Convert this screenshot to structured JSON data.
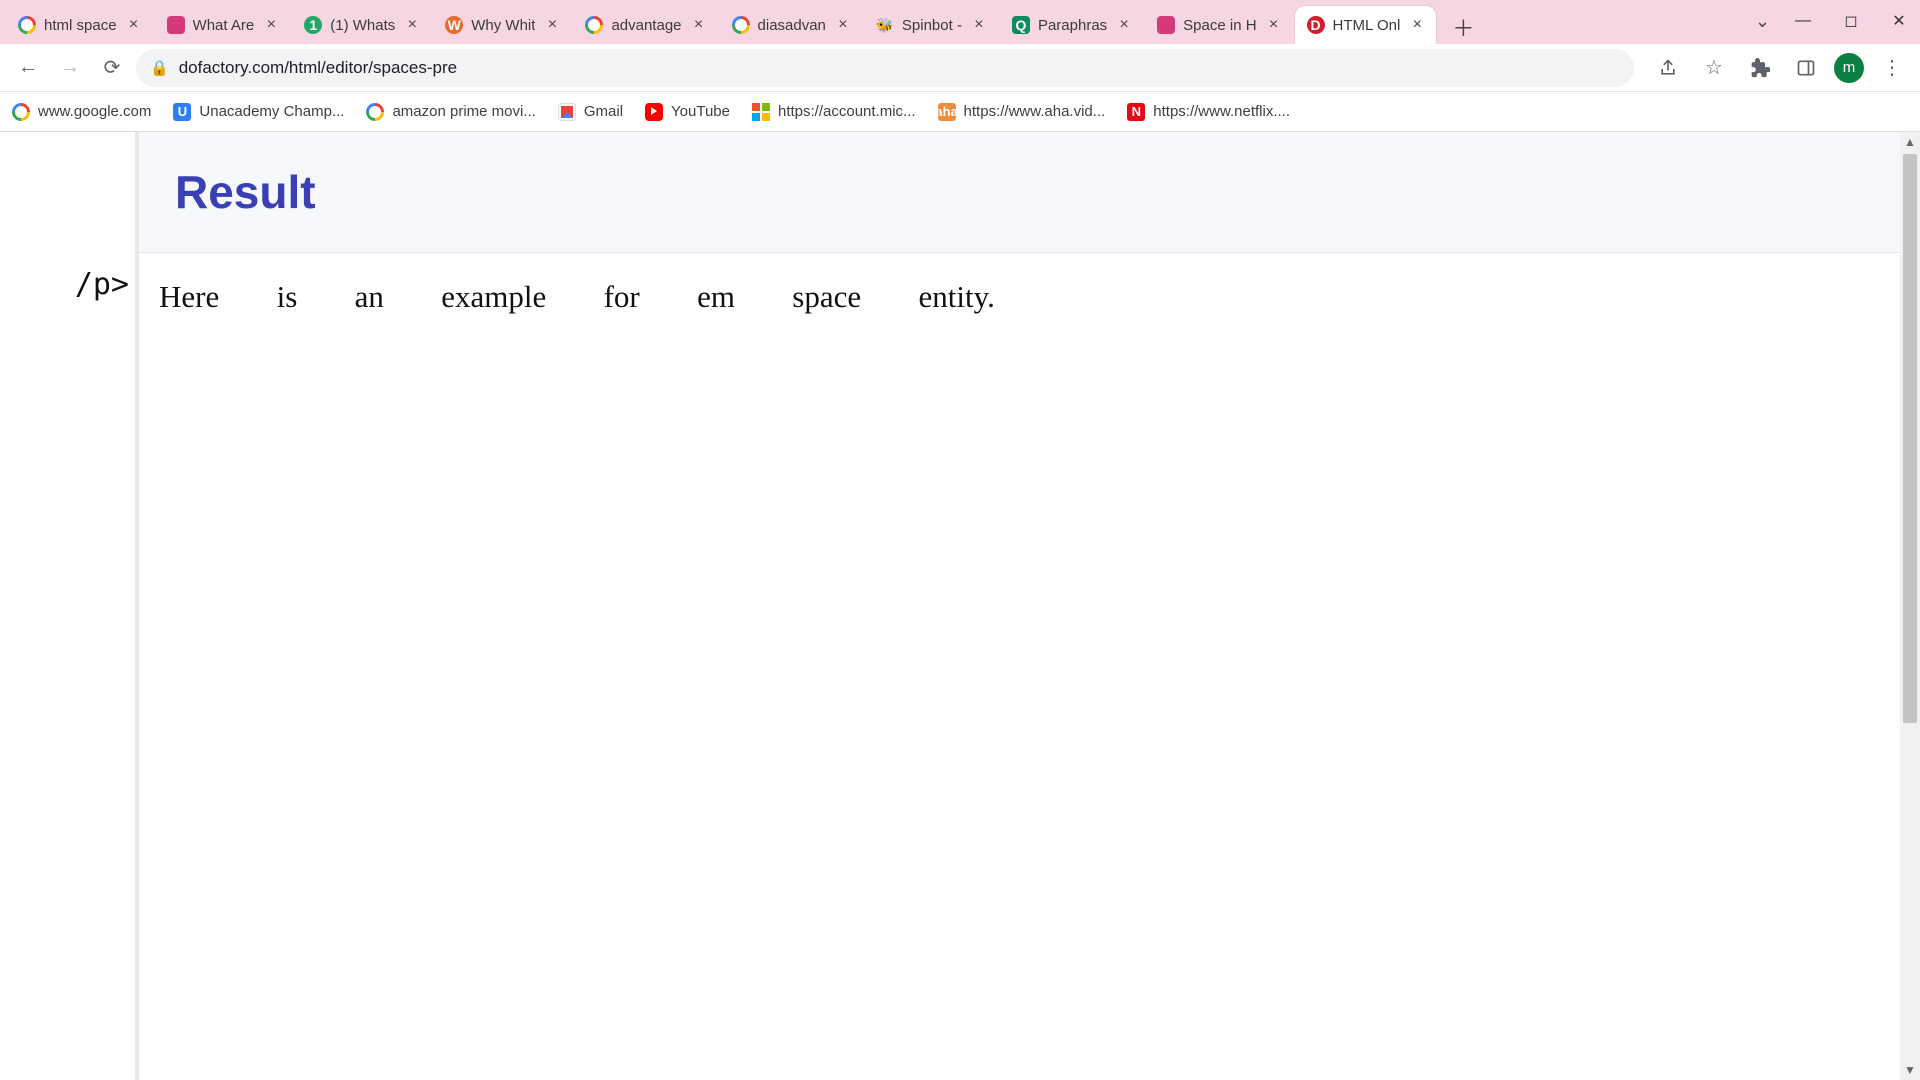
{
  "browser": {
    "tabs": [
      {
        "favClass": "g_multicolor",
        "title": "html space"
      },
      {
        "favClass": "fav-pink",
        "favText": "",
        "title": "What Are"
      },
      {
        "favClass": "fav-green",
        "favText": "1",
        "title": "(1) Whats"
      },
      {
        "favClass": "fav-orange",
        "favText": "W",
        "title": "Why Whit"
      },
      {
        "favClass": "g_multicolor",
        "title": "advantage"
      },
      {
        "favClass": "g_multicolor",
        "title": "diasadvan"
      },
      {
        "favClass": "fav-bee",
        "favText": "🐝",
        "title": "Spinbot -"
      },
      {
        "favClass": "fav-greenq",
        "favText": "Q",
        "title": "Paraphras"
      },
      {
        "favClass": "fav-pink",
        "favText": "",
        "title": "Space in H"
      },
      {
        "favClass": "fav-red",
        "favText": "D",
        "title": "HTML Onl"
      }
    ],
    "activeTabIndex": 9,
    "url": "dofactory.com/html/editor/spaces-pre",
    "avatarLetter": "m",
    "bookmarks": [
      {
        "favClass": "bf-goog",
        "label": "www.google.com"
      },
      {
        "favClass": "bf-blue",
        "favText": "U",
        "label": "Unacademy Champ..."
      },
      {
        "favClass": "bf-goog",
        "label": "amazon prime movi..."
      },
      {
        "favClass": "bf-gmail",
        "label": "Gmail"
      },
      {
        "favClass": "bf-yt",
        "label": "YouTube"
      },
      {
        "favClass": "bf-ms",
        "label": "https://account.mic..."
      },
      {
        "favClass": "bf-aha",
        "favText": "aha",
        "label": "https://www.aha.vid..."
      },
      {
        "favClass": "bf-nflx",
        "favText": "N",
        "label": "https://www.netflix...."
      }
    ]
  },
  "page": {
    "codeFragment": "/p>",
    "resultHeading": "Result",
    "resultParagraph": "Here is an example for em space entity."
  }
}
